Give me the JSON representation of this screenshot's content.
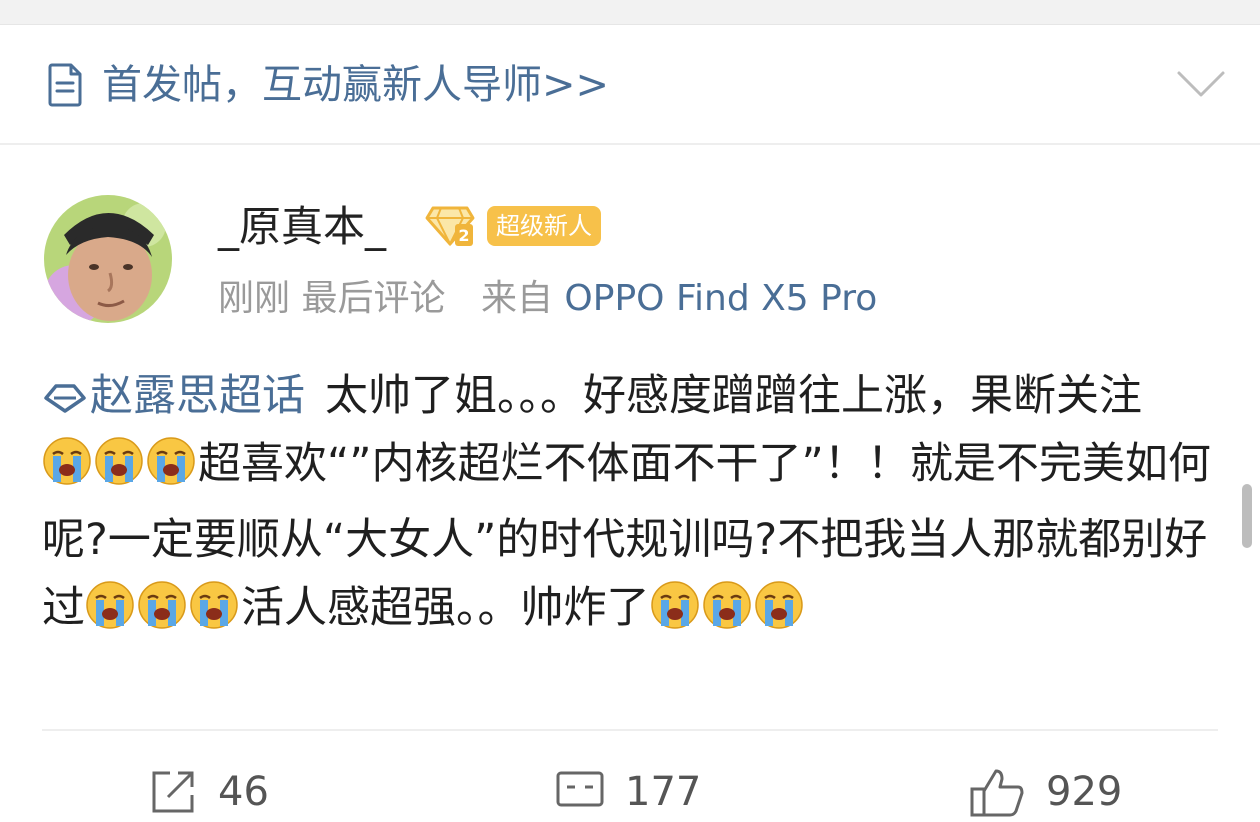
{
  "banner": {
    "text": "首发帖，互动赢新人导师>>",
    "icon": "document-icon",
    "chevron_icon": "chevron-down-icon"
  },
  "post": {
    "username": "_原真本_",
    "badge_level": "超级新人",
    "time": "刚刚",
    "last_comment": "最后评论",
    "source_prefix": "来自",
    "device": "OPPO Find X5 Pro",
    "topic": "赵露思超话",
    "segments": [
      "太帅了姐。。。好感度蹭蹭往上涨，果断关注",
      "超喜欢“”内核超烂不体面不干了”！！就是不完美如何呢?一定要顺从“大女人”的时代规训吗?不把我当人那就都别好过",
      "活人感超强。。帅炸了"
    ],
    "emoji_name": "crying-face-emoji"
  },
  "actions": {
    "share_count": "46",
    "comment_count": "177",
    "like_count": "929"
  },
  "colors": {
    "link": "#4a6e96",
    "badge_bg": "#f7c14a",
    "emoji_face": "#f9c743",
    "tear": "#5aa7e6"
  }
}
